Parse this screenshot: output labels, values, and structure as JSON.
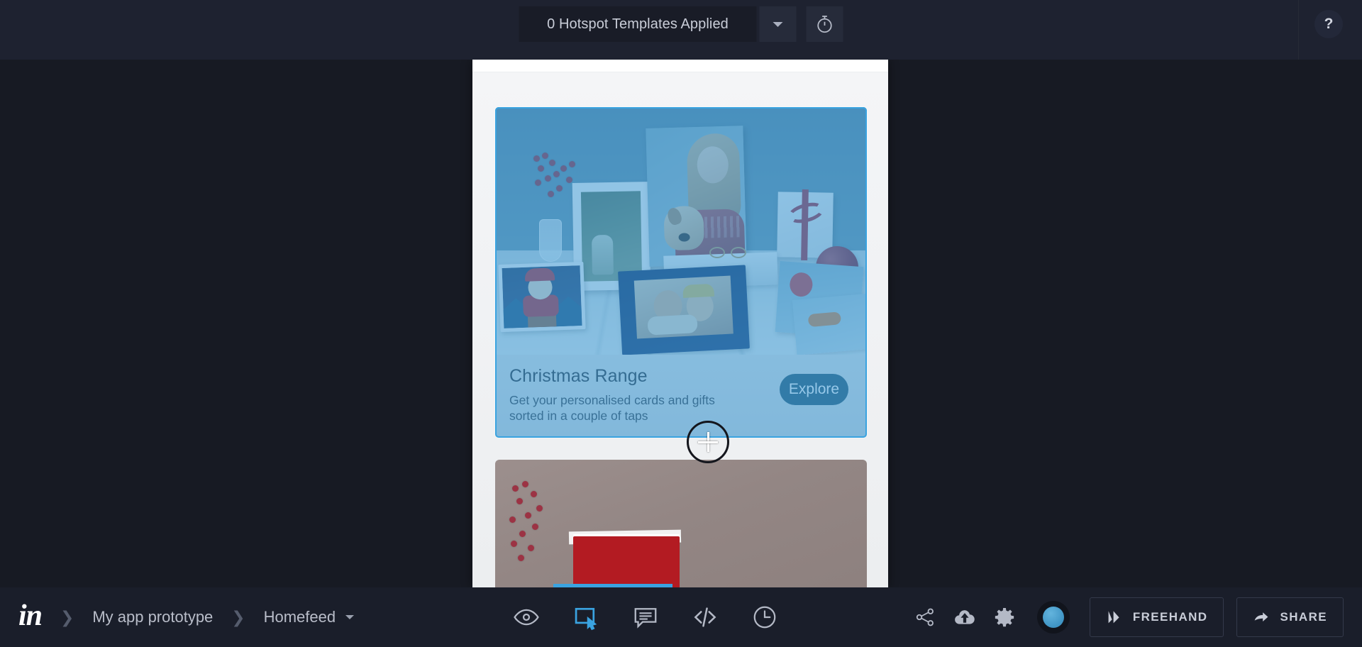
{
  "app": {
    "name": "InVision",
    "logo_text": "in",
    "background_color": "#171a23",
    "accent_color": "#3aa3e0"
  },
  "topbar": {
    "hotspot_templates_label": "0 Hotspot Templates Applied",
    "templates_dropdown_icon": "chevron-down-icon",
    "timer_icon": "stopwatch-icon",
    "help_label": "?"
  },
  "canvas": {
    "screen_name": "Homefeed",
    "cards": [
      {
        "title": "Christmas Range",
        "subtitle": "Get your personalised cards and gifts sorted in a couple of taps",
        "cta_label": "Explore",
        "hotspot_selected": true
      },
      {
        "title": "",
        "subtitle": "",
        "cta_label": "",
        "hotspot_selected": false
      }
    ],
    "cursor": "crosshair-hotspot-draw"
  },
  "bottombar": {
    "breadcrumb": [
      {
        "label": "My app prototype",
        "has_caret": false
      },
      {
        "label": "Homefeed",
        "has_caret": true
      }
    ],
    "tools": [
      {
        "name": "preview-tool",
        "icon": "eye-icon",
        "active": false
      },
      {
        "name": "hotspot-tool",
        "icon": "hotspot-icon",
        "active": true
      },
      {
        "name": "comment-tool",
        "icon": "comment-icon",
        "active": false
      },
      {
        "name": "inspect-tool",
        "icon": "code-icon",
        "active": false
      },
      {
        "name": "history-tool",
        "icon": "clock-icon",
        "active": false
      }
    ],
    "right_icons": [
      {
        "name": "share-node-button",
        "icon": "share-icon"
      },
      {
        "name": "upload-button",
        "icon": "cloud-upload-icon"
      },
      {
        "name": "settings-button",
        "icon": "gear-icon"
      },
      {
        "name": "account-avatar",
        "icon": "avatar-icon"
      }
    ],
    "freehand_label": "FREEHAND",
    "share_label": "SHARE"
  }
}
